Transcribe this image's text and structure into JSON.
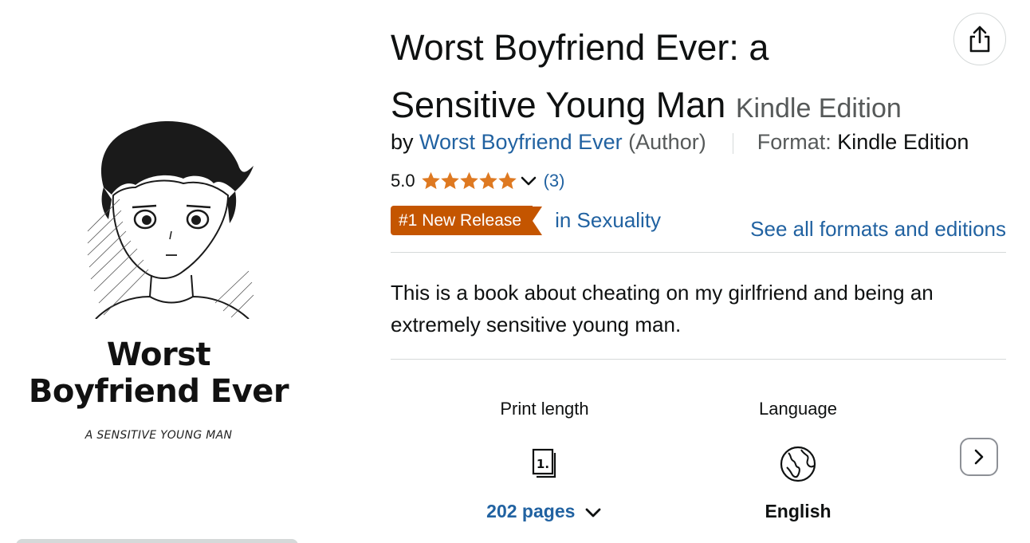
{
  "cover": {
    "title_line1": "Worst",
    "title_line2": "Boyfriend Ever",
    "subtitle": "A SENSITIVE YOUNG MAN"
  },
  "product": {
    "title_line1": "Worst Boyfriend Ever: a",
    "title_line2": "Sensitive Young Man",
    "edition": "Kindle Edition",
    "by": "by",
    "author": "Worst Boyfriend Ever",
    "contributor_role": "(Author)",
    "format_label": "Format:",
    "format_value": "Kindle Edition"
  },
  "rating": {
    "value": "5.0",
    "stars": 5,
    "review_count": "(3)"
  },
  "badge": {
    "label": "#1 New Release",
    "category": "in Sexuality"
  },
  "see_all_formats": "See all formats and editions",
  "description": "This is a book about cheating on my girlfriend and being an extremely sensitive young man.",
  "details": [
    {
      "label": "Print length",
      "icon": "book-pages-icon",
      "value": "202 pages",
      "has_dropdown": true
    },
    {
      "label": "Language",
      "icon": "globe-icon",
      "value": "English",
      "has_dropdown": false
    }
  ],
  "colors": {
    "link": "#2162a1",
    "badge": "#c45500",
    "star": "#de7921",
    "muted": "#565959",
    "divider": "#d5d9d9"
  }
}
